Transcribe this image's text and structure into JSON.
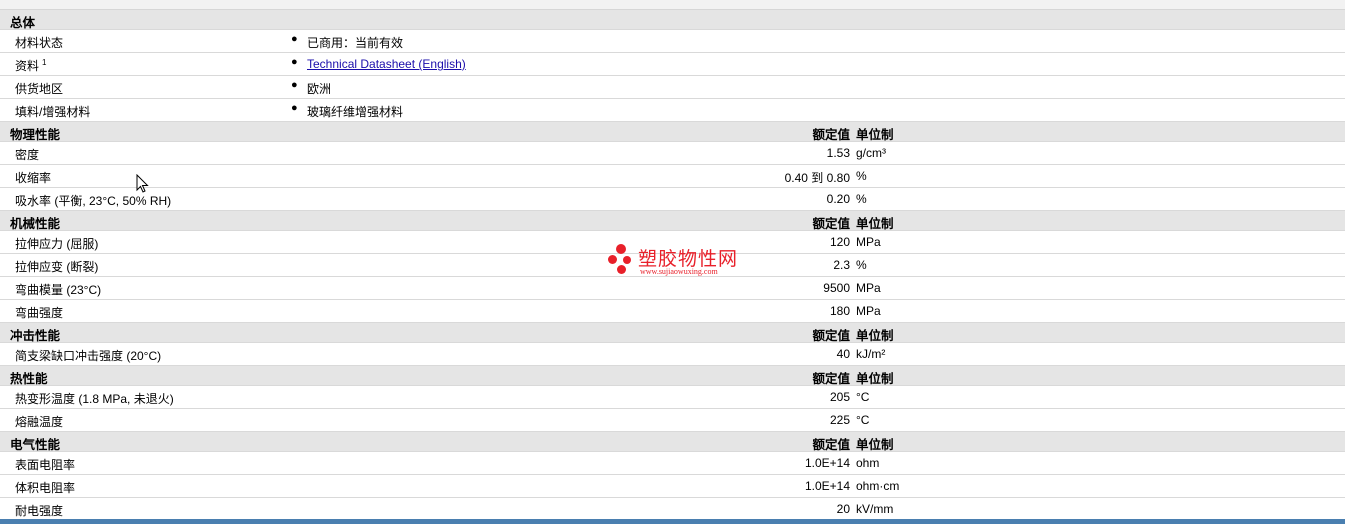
{
  "general": {
    "title": "总体",
    "rows": [
      {
        "label": "材料状态",
        "sup": "",
        "value": "已商用：当前有效",
        "link": false
      },
      {
        "label": "资料",
        "sup": "1",
        "value": "Technical Datasheet (English)",
        "link": true
      },
      {
        "label": "供货地区",
        "sup": "",
        "value": "欧洲",
        "link": false
      },
      {
        "label": "填料/增强材料",
        "sup": "",
        "value": "玻璃纤维增强材料",
        "link": false
      }
    ]
  },
  "sections": [
    {
      "title": "物理性能",
      "value_header": "额定值",
      "unit_header": "单位制",
      "rows": [
        {
          "label": "密度",
          "value": "1.53",
          "unit": "g/cm³"
        },
        {
          "label": "收缩率",
          "value": "0.40 到 0.80",
          "unit": "%"
        },
        {
          "label": "吸水率 (平衡, 23°C, 50% RH)",
          "value": "0.20",
          "unit": "%"
        }
      ]
    },
    {
      "title": "机械性能",
      "value_header": "额定值",
      "unit_header": "单位制",
      "rows": [
        {
          "label": "拉伸应力 (屈服)",
          "value": "120",
          "unit": "MPa"
        },
        {
          "label": "拉伸应变 (断裂)",
          "value": "2.3",
          "unit": "%"
        },
        {
          "label": "弯曲模量 (23°C)",
          "value": "9500",
          "unit": "MPa"
        },
        {
          "label": "弯曲强度",
          "value": "180",
          "unit": "MPa"
        }
      ]
    },
    {
      "title": "冲击性能",
      "value_header": "额定值",
      "unit_header": "单位制",
      "rows": [
        {
          "label": "简支梁缺口冲击强度 (20°C)",
          "value": "40",
          "unit": "kJ/m²"
        }
      ]
    },
    {
      "title": "热性能",
      "value_header": "额定值",
      "unit_header": "单位制",
      "rows": [
        {
          "label": "热变形温度 (1.8 MPa, 未退火)",
          "value": "205",
          "unit": "°C"
        },
        {
          "label": "熔融温度",
          "value": "225",
          "unit": "°C"
        }
      ]
    },
    {
      "title": "电气性能",
      "value_header": "额定值",
      "unit_header": "单位制",
      "rows": [
        {
          "label": "表面电阻率",
          "value": "1.0E+14",
          "unit": "ohm"
        },
        {
          "label": "体积电阻率",
          "value": "1.0E+14",
          "unit": "ohm·cm"
        },
        {
          "label": "耐电强度",
          "value": "20",
          "unit": "kV/mm"
        }
      ]
    }
  ],
  "watermark": {
    "name": "塑胶物性网",
    "url": "www.sujiaowuxing.com",
    "color": "#e8202a"
  },
  "icons": {
    "cursor": "mouse-pointer-icon",
    "bullet": "bullet-dot-icon"
  }
}
